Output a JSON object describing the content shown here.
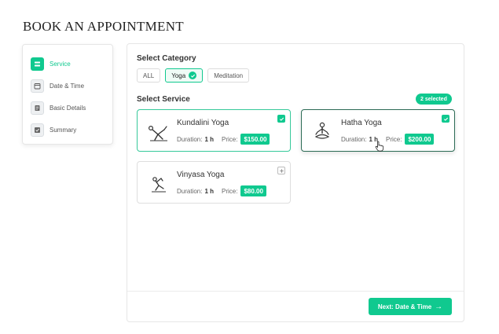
{
  "page": {
    "title": "BOOK AN APPOINTMENT"
  },
  "steps": [
    {
      "label": "Service",
      "icon": "list-icon",
      "active": true
    },
    {
      "label": "Date & Time",
      "icon": "calendar-icon",
      "active": false
    },
    {
      "label": "Basic Details",
      "icon": "document-icon",
      "active": false
    },
    {
      "label": "Summary",
      "icon": "checklist-icon",
      "active": false
    }
  ],
  "category": {
    "title": "Select Category",
    "chips": [
      {
        "label": "ALL",
        "active": false
      },
      {
        "label": "Yoga",
        "active": true
      },
      {
        "label": "Meditation",
        "active": false
      }
    ]
  },
  "service": {
    "title": "Select Service",
    "selected_badge": "2 selected",
    "cards": [
      {
        "name": "Kundalini Yoga",
        "duration_label": "Duration:",
        "duration": "1 h",
        "price_label": "Price:",
        "price": "$150.00",
        "selected": true,
        "illustration": "yoga-pose-icon"
      },
      {
        "name": "Hatha Yoga",
        "duration_label": "Duration:",
        "duration": "1 h",
        "price_label": "Price:",
        "price": "$200.00",
        "selected": true,
        "illustration": "meditation-pose-icon"
      },
      {
        "name": "Vinyasa Yoga",
        "duration_label": "Duration:",
        "duration": "1 h",
        "price_label": "Price:",
        "price": "$80.00",
        "selected": false,
        "illustration": "yoga-stretch-icon"
      }
    ]
  },
  "footer": {
    "next_label": "Next: Date & Time",
    "next_arrow": "→"
  },
  "colors": {
    "accent": "#10c98f",
    "selected_border_dark": "#2c6b55"
  }
}
